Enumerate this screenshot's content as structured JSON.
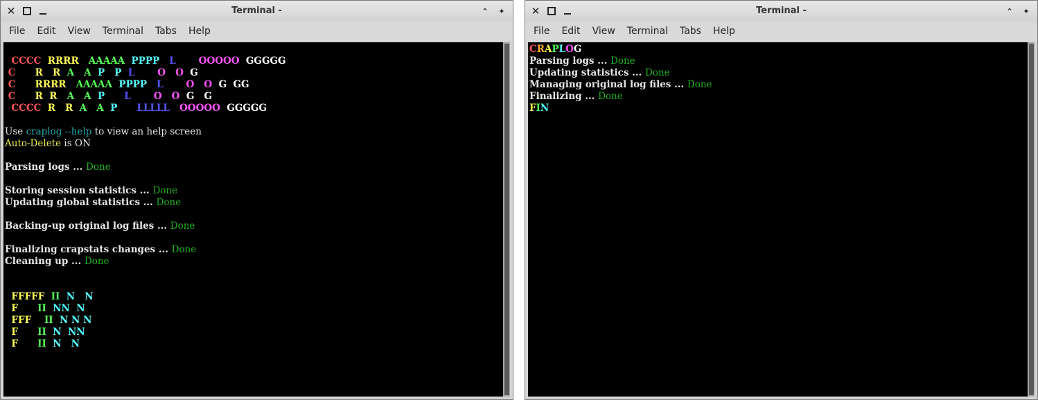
{
  "left_window": {
    "title": "Terminal -",
    "menu": [
      "File",
      "Edit",
      "View",
      "Terminal",
      "Tabs",
      "Help"
    ],
    "banner": {
      "rows": [
        [
          "  CCCC ",
          " RRRR  ",
          " AAAAA ",
          " PPPP  ",
          " L     ",
          "  OOOOO ",
          " GGGGG"
        ],
        [
          " C     ",
          " R   R ",
          " A   A ",
          " P   P ",
          " L     ",
          "  O   O ",
          " G    "
        ],
        [
          " C     ",
          " RRRR  ",
          " AAAAA ",
          " PPPP  ",
          " L     ",
          "  O   O ",
          " G  GG"
        ],
        [
          " C     ",
          " R  R  ",
          " A   A ",
          " P     ",
          " L     ",
          "  O   O ",
          " G   G"
        ],
        [
          "  CCCC ",
          " R   R ",
          " A   A ",
          " P     ",
          " LLLLL ",
          "  OOOOO ",
          " GGGGG"
        ]
      ]
    },
    "help_prefix": "Use ",
    "help_cmd": "craplog --help",
    "help_suffix": " to view an help screen",
    "autodelete_label": "Auto-Delete",
    "autodelete_state": " is ON",
    "done_label": "Done",
    "steps": [
      {
        "text": "Parsing logs ... "
      },
      {
        "text": "Storing session statistics ... "
      },
      {
        "text": "Updating global statistics ... "
      },
      {
        "text": "Backing-up original log files ... "
      },
      {
        "text": "Finalizing crapstats changes ... "
      },
      {
        "text": "Cleaning up ... "
      }
    ],
    "fin_banner": {
      "rows": [
        [
          "  FFFFF ",
          " II ",
          " N   N"
        ],
        [
          "  F     ",
          " II ",
          " NN  N"
        ],
        [
          "  FFF   ",
          " II ",
          " N N N"
        ],
        [
          "  F     ",
          " II ",
          " N  NN"
        ],
        [
          "  F     ",
          " II ",
          " N   N"
        ]
      ]
    }
  },
  "right_window": {
    "title": "Terminal -",
    "menu": [
      "File",
      "Edit",
      "View",
      "Terminal",
      "Tabs",
      "Help"
    ],
    "logo_letters": [
      "C",
      "R",
      "A",
      "P",
      "L",
      "O",
      "G"
    ],
    "done_label": "Done",
    "steps": [
      {
        "text": "Parsing logs ... "
      },
      {
        "text": "Updating statistics ... "
      },
      {
        "text": "Managing original log files ... "
      },
      {
        "text": "Finalizing ... "
      }
    ],
    "fin_letters": [
      "F",
      "I",
      "N"
    ]
  },
  "colors": {
    "terminal_bg": "#000000",
    "done_green": "#22b022",
    "command_cyan": "#22aab0"
  }
}
